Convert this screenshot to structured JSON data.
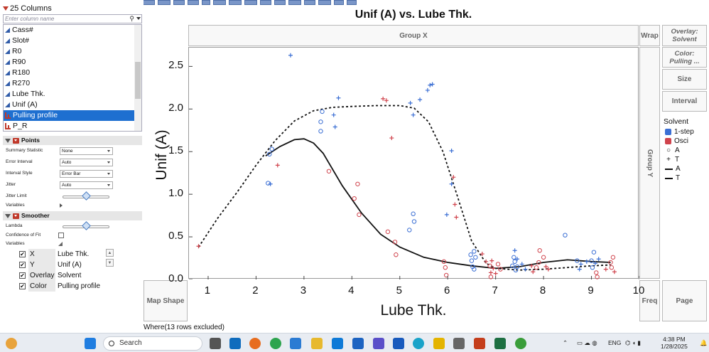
{
  "left_panel": {
    "columns_header": "25 Columns",
    "search_placeholder": "Enter column name",
    "columns": [
      {
        "name": "Cass#",
        "selected": false,
        "type": "continuous"
      },
      {
        "name": "Slot#",
        "selected": false,
        "type": "continuous"
      },
      {
        "name": "R0",
        "selected": false,
        "type": "continuous"
      },
      {
        "name": "R90",
        "selected": false,
        "type": "continuous"
      },
      {
        "name": "R180",
        "selected": false,
        "type": "continuous"
      },
      {
        "name": "R270",
        "selected": false,
        "type": "continuous"
      },
      {
        "name": "Lube Thk.",
        "selected": false,
        "type": "continuous"
      },
      {
        "name": "Unif (A)",
        "selected": false,
        "type": "continuous"
      },
      {
        "name": "Pulling profile",
        "selected": true,
        "type": "nominal"
      },
      {
        "name": "P_R",
        "selected": false,
        "type": "nominal"
      }
    ],
    "points_section": {
      "title": "Points",
      "rows": [
        {
          "label": "Summary Statistic",
          "value": "None"
        },
        {
          "label": "Error Interval",
          "value": "Auto"
        },
        {
          "label": "Interval Style",
          "value": "Error Bar"
        },
        {
          "label": "Jitter",
          "value": "Auto"
        },
        {
          "label": "Jitter Limit",
          "value": ""
        },
        {
          "label": "Variables",
          "value": ""
        }
      ]
    },
    "smoother_section": {
      "title": "Smoother",
      "rows": [
        {
          "label": "Lambda"
        },
        {
          "label": "Confidence of Fit"
        },
        {
          "label": "Variables"
        }
      ]
    },
    "roles": [
      {
        "role": "X",
        "column": "Lube Thk.",
        "checked": true
      },
      {
        "role": "Y",
        "column": "Unif (A)",
        "checked": true
      },
      {
        "role": "Overlay",
        "column": "Solvent",
        "checked": true
      },
      {
        "role": "Color",
        "column": "Pulling profile",
        "checked": true
      }
    ]
  },
  "graph": {
    "title": "Unif (A) vs. Lube Thk.",
    "group_x_label": "Group X",
    "group_y_label": "Group Y",
    "wrap_label": "Wrap",
    "overlay_zone": {
      "label": "Overlay:",
      "value": "Solvent"
    },
    "color_zone": {
      "label": "Color:",
      "value": "Pulling ..."
    },
    "size_label": "Size",
    "interval_label": "Interval",
    "map_shape_label": "Map Shape",
    "freq_label": "Freq",
    "page_label": "Page",
    "where_text": "Where(13 rows excluded)",
    "legend": {
      "title": "Solvent",
      "items": [
        {
          "label": "1-step",
          "kind": "color",
          "color": "#3b6fd4"
        },
        {
          "label": "Osci",
          "kind": "color",
          "color": "#d0434c"
        },
        {
          "label": "A",
          "kind": "marker-circle"
        },
        {
          "label": "T",
          "kind": "marker-plus"
        },
        {
          "label": "A",
          "kind": "line-solid"
        },
        {
          "label": "T",
          "kind": "line-dashed"
        }
      ]
    }
  },
  "chart_data": {
    "type": "scatter",
    "title": "Unif (A) vs. Lube Thk.",
    "xlabel": "Lube Thk.",
    "ylabel": "Unif (A)",
    "xlim": [
      0.6,
      10
    ],
    "ylim": [
      0,
      2.72
    ],
    "x_ticks": [
      "1",
      "2",
      "3",
      "4",
      "5",
      "6",
      "7",
      "8",
      "9",
      "10"
    ],
    "y_ticks": [
      "0.0",
      "0.5",
      "1.0",
      "1.5",
      "2.0",
      "2.5"
    ],
    "colors": {
      "1-step": "#3b6fd4",
      "Osci": "#d0434c"
    },
    "points": [
      {
        "x": 0.8,
        "y": 0.39,
        "marker": "T",
        "color": "Osci"
      },
      {
        "x": 2.25,
        "y": 1.13,
        "marker": "A",
        "color": "1-step"
      },
      {
        "x": 2.3,
        "y": 1.12,
        "marker": "T",
        "color": "1-step"
      },
      {
        "x": 2.28,
        "y": 1.47,
        "marker": "A",
        "color": "1-step"
      },
      {
        "x": 2.33,
        "y": 1.53,
        "marker": "A",
        "color": "1-step"
      },
      {
        "x": 2.45,
        "y": 1.34,
        "marker": "T",
        "color": "Osci"
      },
      {
        "x": 2.72,
        "y": 2.63,
        "marker": "T",
        "color": "1-step"
      },
      {
        "x": 3.35,
        "y": 1.85,
        "marker": "A",
        "color": "1-step"
      },
      {
        "x": 3.35,
        "y": 1.74,
        "marker": "A",
        "color": "1-step"
      },
      {
        "x": 3.38,
        "y": 1.97,
        "marker": "A",
        "color": "1-step"
      },
      {
        "x": 3.52,
        "y": 1.27,
        "marker": "A",
        "color": "Osci"
      },
      {
        "x": 3.62,
        "y": 1.93,
        "marker": "T",
        "color": "1-step"
      },
      {
        "x": 3.65,
        "y": 1.79,
        "marker": "T",
        "color": "1-step"
      },
      {
        "x": 3.72,
        "y": 2.13,
        "marker": "T",
        "color": "1-step"
      },
      {
        "x": 4.05,
        "y": 0.95,
        "marker": "A",
        "color": "Osci"
      },
      {
        "x": 4.12,
        "y": 1.12,
        "marker": "A",
        "color": "Osci"
      },
      {
        "x": 4.15,
        "y": 0.76,
        "marker": "A",
        "color": "Osci"
      },
      {
        "x": 4.65,
        "y": 2.12,
        "marker": "T",
        "color": "Osci"
      },
      {
        "x": 4.72,
        "y": 2.1,
        "marker": "T",
        "color": "Osci"
      },
      {
        "x": 4.75,
        "y": 0.56,
        "marker": "A",
        "color": "Osci"
      },
      {
        "x": 4.83,
        "y": 1.66,
        "marker": "T",
        "color": "Osci"
      },
      {
        "x": 4.9,
        "y": 0.44,
        "marker": "A",
        "color": "Osci"
      },
      {
        "x": 4.92,
        "y": 0.29,
        "marker": "A",
        "color": "Osci"
      },
      {
        "x": 5.2,
        "y": 0.58,
        "marker": "A",
        "color": "1-step"
      },
      {
        "x": 5.22,
        "y": 2.07,
        "marker": "T",
        "color": "1-step"
      },
      {
        "x": 5.28,
        "y": 1.93,
        "marker": "T",
        "color": "1-step"
      },
      {
        "x": 5.28,
        "y": 0.77,
        "marker": "A",
        "color": "1-step"
      },
      {
        "x": 5.3,
        "y": 0.68,
        "marker": "A",
        "color": "1-step"
      },
      {
        "x": 5.42,
        "y": 2.11,
        "marker": "T",
        "color": "1-step"
      },
      {
        "x": 5.58,
        "y": 2.22,
        "marker": "T",
        "color": "1-step"
      },
      {
        "x": 5.63,
        "y": 2.28,
        "marker": "T",
        "color": "1-step"
      },
      {
        "x": 5.68,
        "y": 2.29,
        "marker": "T",
        "color": "1-step"
      },
      {
        "x": 5.92,
        "y": 0.21,
        "marker": "A",
        "color": "Osci"
      },
      {
        "x": 5.95,
        "y": 0.14,
        "marker": "A",
        "color": "Osci"
      },
      {
        "x": 5.97,
        "y": 0.05,
        "marker": "A",
        "color": "Osci"
      },
      {
        "x": 5.98,
        "y": 0.76,
        "marker": "T",
        "color": "1-step"
      },
      {
        "x": 6.08,
        "y": 1.51,
        "marker": "T",
        "color": "1-step"
      },
      {
        "x": 6.08,
        "y": 1.12,
        "marker": "T",
        "color": "1-step"
      },
      {
        "x": 6.12,
        "y": 1.2,
        "marker": "T",
        "color": "Osci"
      },
      {
        "x": 6.15,
        "y": 0.88,
        "marker": "T",
        "color": "Osci"
      },
      {
        "x": 6.18,
        "y": 0.73,
        "marker": "T",
        "color": "Osci"
      },
      {
        "x": 6.48,
        "y": 0.29,
        "marker": "A",
        "color": "1-step"
      },
      {
        "x": 6.5,
        "y": 0.22,
        "marker": "A",
        "color": "1-step"
      },
      {
        "x": 6.52,
        "y": 0.15,
        "marker": "A",
        "color": "1-step"
      },
      {
        "x": 6.55,
        "y": 0.33,
        "marker": "A",
        "color": "1-step"
      },
      {
        "x": 6.55,
        "y": 0.12,
        "marker": "A",
        "color": "1-step"
      },
      {
        "x": 6.58,
        "y": 0.26,
        "marker": "A",
        "color": "1-step"
      },
      {
        "x": 6.72,
        "y": 0.3,
        "marker": "T",
        "color": "Osci"
      },
      {
        "x": 6.8,
        "y": 0.21,
        "marker": "T",
        "color": "Osci"
      },
      {
        "x": 6.88,
        "y": 0.16,
        "marker": "A",
        "color": "Osci"
      },
      {
        "x": 6.9,
        "y": 0.08,
        "marker": "T",
        "color": "Osci"
      },
      {
        "x": 6.9,
        "y": 0.03,
        "marker": "A",
        "color": "Osci"
      },
      {
        "x": 6.92,
        "y": 0.22,
        "marker": "T",
        "color": "Osci"
      },
      {
        "x": 6.95,
        "y": 0.13,
        "marker": "T",
        "color": "Osci"
      },
      {
        "x": 7.0,
        "y": 0.07,
        "marker": "T",
        "color": "Osci"
      },
      {
        "x": 7.05,
        "y": 0.18,
        "marker": "A",
        "color": "Osci"
      },
      {
        "x": 7.1,
        "y": 0.12,
        "marker": "A",
        "color": "Osci"
      },
      {
        "x": 7.35,
        "y": 0.16,
        "marker": "A",
        "color": "1-step"
      },
      {
        "x": 7.38,
        "y": 0.26,
        "marker": "A",
        "color": "1-step"
      },
      {
        "x": 7.4,
        "y": 0.34,
        "marker": "T",
        "color": "1-step"
      },
      {
        "x": 7.4,
        "y": 0.21,
        "marker": "A",
        "color": "1-step"
      },
      {
        "x": 7.42,
        "y": 0.11,
        "marker": "A",
        "color": "1-step"
      },
      {
        "x": 7.45,
        "y": 0.24,
        "marker": "T",
        "color": "1-step"
      },
      {
        "x": 7.45,
        "y": 0.15,
        "marker": "A",
        "color": "1-step"
      },
      {
        "x": 7.55,
        "y": 0.18,
        "marker": "T",
        "color": "1-step"
      },
      {
        "x": 7.62,
        "y": 0.12,
        "marker": "T",
        "color": "1-step"
      },
      {
        "x": 7.75,
        "y": 0.16,
        "marker": "T",
        "color": "Osci"
      },
      {
        "x": 7.78,
        "y": 0.09,
        "marker": "T",
        "color": "Osci"
      },
      {
        "x": 7.85,
        "y": 0.14,
        "marker": "A",
        "color": "Osci"
      },
      {
        "x": 7.9,
        "y": 0.2,
        "marker": "A",
        "color": "Osci"
      },
      {
        "x": 7.92,
        "y": 0.34,
        "marker": "A",
        "color": "Osci"
      },
      {
        "x": 8.0,
        "y": 0.26,
        "marker": "A",
        "color": "Osci"
      },
      {
        "x": 8.05,
        "y": 0.15,
        "marker": "T",
        "color": "Osci"
      },
      {
        "x": 8.1,
        "y": 0.12,
        "marker": "T",
        "color": "Osci"
      },
      {
        "x": 8.45,
        "y": 0.52,
        "marker": "A",
        "color": "1-step"
      },
      {
        "x": 8.7,
        "y": 0.22,
        "marker": "A",
        "color": "1-step"
      },
      {
        "x": 8.75,
        "y": 0.12,
        "marker": "T",
        "color": "1-step"
      },
      {
        "x": 8.78,
        "y": 0.18,
        "marker": "T",
        "color": "1-step"
      },
      {
        "x": 8.9,
        "y": 0.21,
        "marker": "T",
        "color": "1-step"
      },
      {
        "x": 9.0,
        "y": 0.22,
        "marker": "A",
        "color": "1-step"
      },
      {
        "x": 9.02,
        "y": 0.14,
        "marker": "A",
        "color": "1-step"
      },
      {
        "x": 9.05,
        "y": 0.32,
        "marker": "A",
        "color": "1-step"
      },
      {
        "x": 9.08,
        "y": 0.19,
        "marker": "T",
        "color": "1-step"
      },
      {
        "x": 9.1,
        "y": 0.08,
        "marker": "A",
        "color": "Osci"
      },
      {
        "x": 9.12,
        "y": 0.03,
        "marker": "A",
        "color": "Osci"
      },
      {
        "x": 9.15,
        "y": 0.24,
        "marker": "T",
        "color": "1-step"
      },
      {
        "x": 9.3,
        "y": 0.12,
        "marker": "T",
        "color": "Osci"
      },
      {
        "x": 9.4,
        "y": 0.2,
        "marker": "A",
        "color": "Osci"
      },
      {
        "x": 9.42,
        "y": 0.14,
        "marker": "A",
        "color": "Osci"
      },
      {
        "x": 9.45,
        "y": 0.26,
        "marker": "A",
        "color": "Osci"
      },
      {
        "x": 9.48,
        "y": 0.09,
        "marker": "T",
        "color": "Osci"
      }
    ],
    "smoother_A": {
      "style": "solid",
      "x": [
        2.2,
        2.5,
        2.8,
        3.0,
        3.2,
        3.4,
        3.8,
        4.2,
        4.6,
        5.0,
        5.5,
        6.0,
        6.5,
        7.0,
        7.5,
        8.0,
        8.5,
        9.0,
        9.4
      ],
      "y": [
        1.45,
        1.56,
        1.64,
        1.65,
        1.6,
        1.48,
        1.1,
        0.78,
        0.53,
        0.38,
        0.26,
        0.2,
        0.16,
        0.13,
        0.15,
        0.2,
        0.23,
        0.21,
        0.2
      ]
    },
    "smoother_T": {
      "style": "dashed",
      "x": [
        0.8,
        1.2,
        1.6,
        2.0,
        2.4,
        2.8,
        3.2,
        3.6,
        4.0,
        4.5,
        5.0,
        5.3,
        5.6,
        5.9,
        6.2,
        6.5,
        6.8,
        7.0,
        7.5,
        8.0,
        8.5,
        9.0,
        9.4
      ],
      "y": [
        0.38,
        0.72,
        1.02,
        1.34,
        1.63,
        1.86,
        1.98,
        2.02,
        2.03,
        2.04,
        2.04,
        2.01,
        1.85,
        1.5,
        0.98,
        0.45,
        0.19,
        0.13,
        0.11,
        0.12,
        0.14,
        0.16,
        0.17
      ]
    }
  },
  "taskbar": {
    "search_label": "Search",
    "language": "ENG",
    "time": "4:38 PM",
    "date": "1/28/2025"
  }
}
